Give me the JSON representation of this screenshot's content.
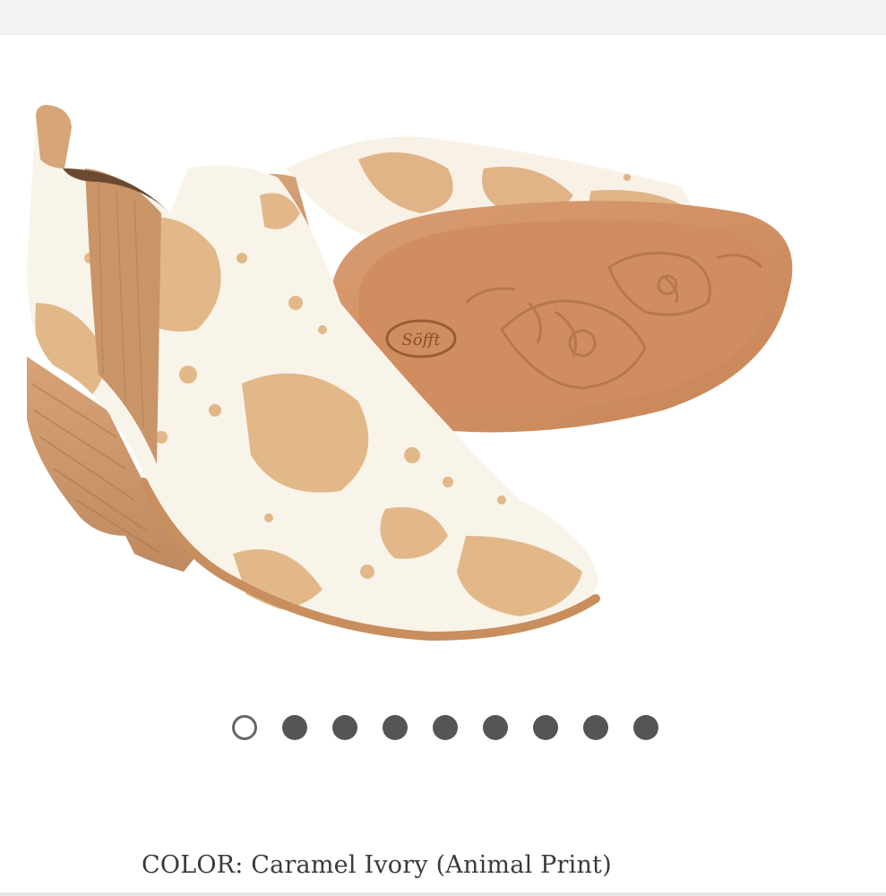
{
  "gallery": {
    "image_alt": "Caramel Ivory animal print ankle booties",
    "brand_stamp": "Söfft",
    "dots_count": 9,
    "active_index": 0
  },
  "color": {
    "label": "COLOR:",
    "value": "Caramel Ivory (Animal Print)"
  }
}
